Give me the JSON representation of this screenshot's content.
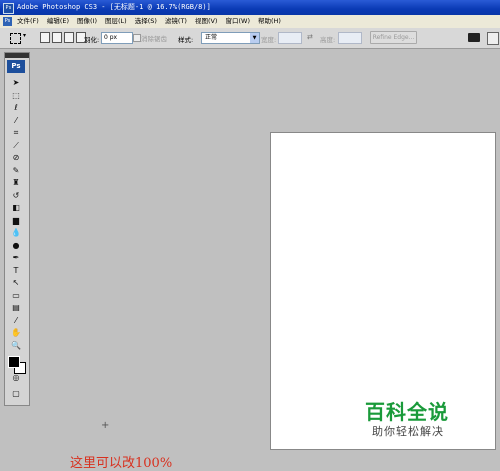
{
  "window": {
    "title": "Adobe Photoshop CS3 - [无标题-1 @ 16.7%(RGB/8)]",
    "icon_label": "Ps"
  },
  "menu": {
    "items": [
      "文件(F)",
      "编辑(E)",
      "图像(I)",
      "图层(L)",
      "选择(S)",
      "滤镜(T)",
      "视图(V)",
      "窗口(W)",
      "帮助(H)"
    ]
  },
  "options": {
    "feather_label": "羽化:",
    "feather_value": "0 px",
    "anti_alias_label": "消除锯齿",
    "style_label": "样式:",
    "style_value": "正常",
    "width_label": "宽度:",
    "height_label": "高度:",
    "refine_edge_label": "Refine Edge..."
  },
  "toolbox": {
    "logo": "Ps",
    "tools": [
      {
        "name": "move-tool",
        "glyph": "➤"
      },
      {
        "name": "marquee-tool",
        "glyph": "⬚"
      },
      {
        "name": "lasso-tool",
        "glyph": "ℓ"
      },
      {
        "name": "magic-wand-tool",
        "glyph": "⁄"
      },
      {
        "name": "crop-tool",
        "glyph": "⌗"
      },
      {
        "name": "slice-tool",
        "glyph": "⟋"
      },
      {
        "name": "healing-brush-tool",
        "glyph": "⊘"
      },
      {
        "name": "brush-tool",
        "glyph": "✎"
      },
      {
        "name": "clone-stamp-tool",
        "glyph": "♜"
      },
      {
        "name": "history-brush-tool",
        "glyph": "↺"
      },
      {
        "name": "eraser-tool",
        "glyph": "◧"
      },
      {
        "name": "gradient-tool",
        "glyph": "▆"
      },
      {
        "name": "blur-tool",
        "glyph": "💧"
      },
      {
        "name": "dodge-tool",
        "glyph": "●"
      },
      {
        "name": "pen-tool",
        "glyph": "✒"
      },
      {
        "name": "type-tool",
        "glyph": "T"
      },
      {
        "name": "path-selection-tool",
        "glyph": "↖"
      },
      {
        "name": "shape-tool",
        "glyph": "▭"
      },
      {
        "name": "notes-tool",
        "glyph": "▤"
      },
      {
        "name": "eyedropper-tool",
        "glyph": "⁄"
      },
      {
        "name": "hand-tool",
        "glyph": "✋"
      },
      {
        "name": "zoom-tool",
        "glyph": "🔍"
      }
    ],
    "quick_mask_glyph": "◎",
    "screen_mode_glyph": "▢"
  },
  "overlay": {
    "annotation": "这里可以改100%",
    "crosshair": "+",
    "watermark_title": "百科全说",
    "watermark_subtitle": "助你轻松解决"
  },
  "colors": {
    "titlebar": "#0a3ab5",
    "workspace": "#c0c0c0",
    "annotation": "#d8301e",
    "watermark": "#1a9a3a"
  }
}
